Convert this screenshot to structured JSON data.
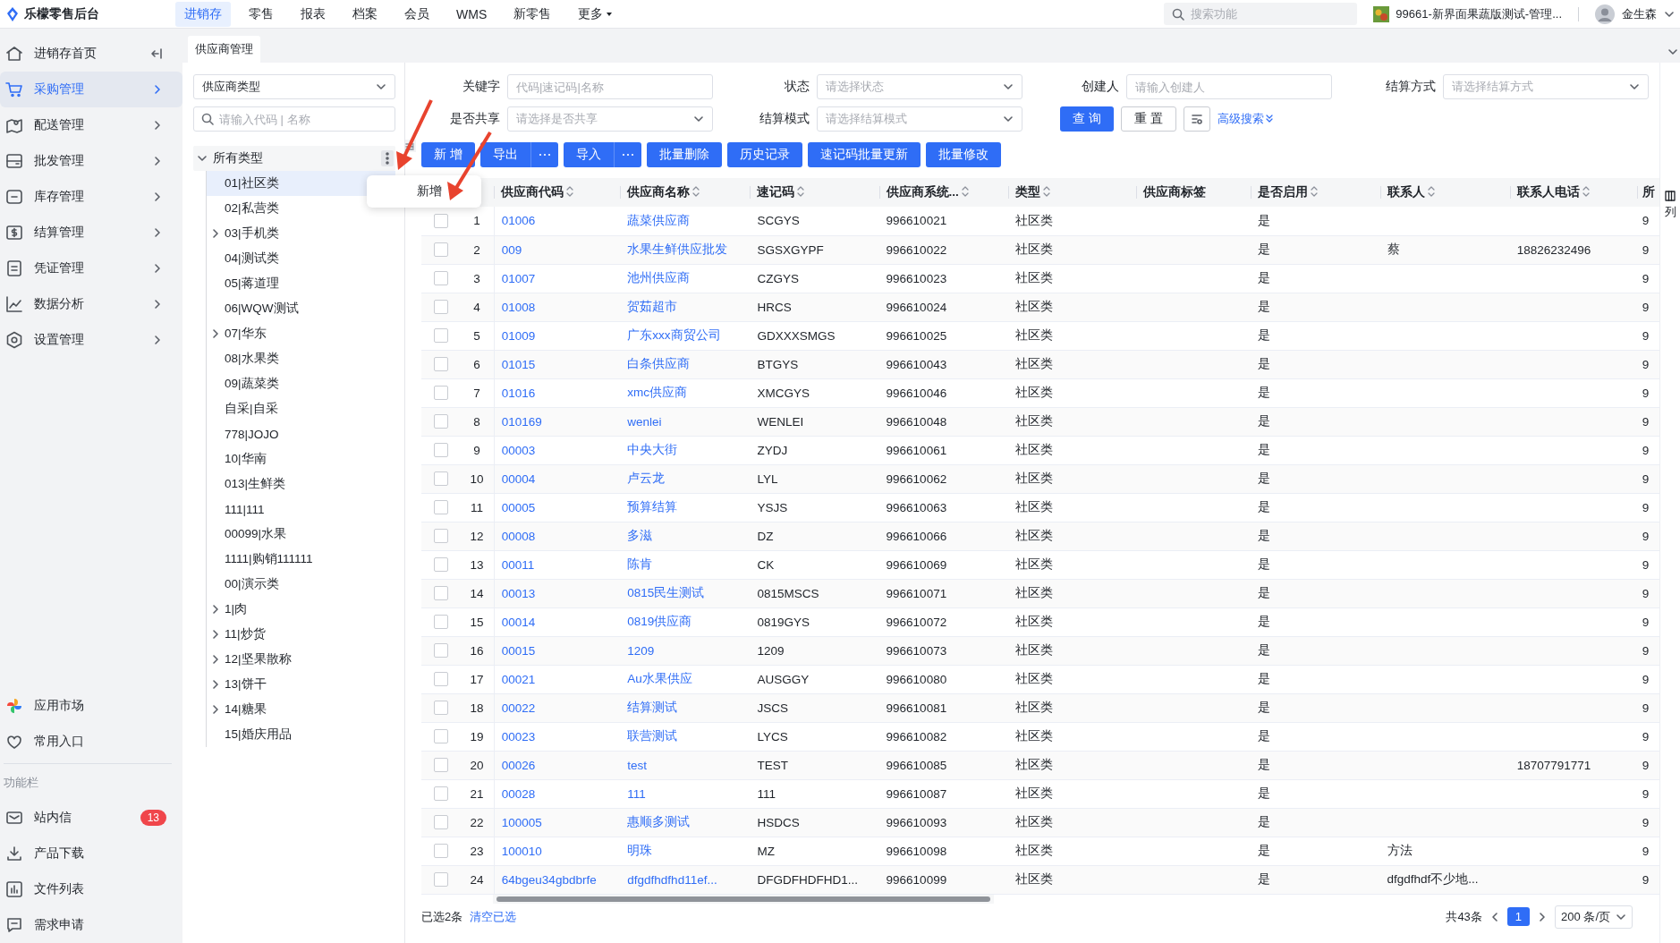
{
  "app": {
    "title": "乐檬零售后台"
  },
  "top_nav": [
    {
      "label": "进销存",
      "selected": true,
      "dropdown": false
    },
    {
      "label": "零售",
      "selected": false,
      "dropdown": false
    },
    {
      "label": "报表",
      "selected": false,
      "dropdown": false
    },
    {
      "label": "档案",
      "selected": false,
      "dropdown": false
    },
    {
      "label": "会员",
      "selected": false,
      "dropdown": false
    },
    {
      "label": "WMS",
      "selected": false,
      "dropdown": false
    },
    {
      "label": "新零售",
      "selected": false,
      "dropdown": false
    },
    {
      "label": "更多",
      "selected": false,
      "dropdown": true
    }
  ],
  "search": {
    "placeholder": "搜索功能"
  },
  "store": {
    "name": "99661-新界面果蔬版测试-管理..."
  },
  "user": {
    "name": "金生森"
  },
  "sidebar": {
    "items": [
      {
        "label": "进销存首页",
        "selected": false,
        "expandable": false
      },
      {
        "label": "采购管理",
        "selected": true,
        "expandable": true
      },
      {
        "label": "配送管理",
        "selected": false,
        "expandable": true
      },
      {
        "label": "批发管理",
        "selected": false,
        "expandable": true
      },
      {
        "label": "库存管理",
        "selected": false,
        "expandable": true
      },
      {
        "label": "结算管理",
        "selected": false,
        "expandable": true
      },
      {
        "label": "凭证管理",
        "selected": false,
        "expandable": true
      },
      {
        "label": "数据分析",
        "selected": false,
        "expandable": true
      },
      {
        "label": "设置管理",
        "selected": false,
        "expandable": true
      }
    ],
    "bottom_items": [
      {
        "label": "应用市场"
      },
      {
        "label": "常用入口"
      }
    ],
    "section_label": "功能栏",
    "tool_items": [
      {
        "label": "站内信",
        "badge": "13"
      },
      {
        "label": "产品下载"
      },
      {
        "label": "文件列表"
      },
      {
        "label": "需求申请"
      }
    ]
  },
  "page_tabs": [
    {
      "label": "供应商管理",
      "selected": true
    }
  ],
  "tree_panel": {
    "type_select": {
      "value": "供应商类型"
    },
    "search": {
      "placeholder": "请输入代码 | 名称"
    },
    "tree": {
      "label": "所有类型",
      "expanded": true,
      "children": [
        {
          "label": "01|社区类",
          "selected": true,
          "expandable": false
        },
        {
          "label": "02|私营类",
          "selected": false,
          "expandable": false
        },
        {
          "label": "03|手机类",
          "selected": false,
          "expandable": true
        },
        {
          "label": "04|测试类",
          "selected": false,
          "expandable": false
        },
        {
          "label": "05|蒋道理",
          "selected": false,
          "expandable": false
        },
        {
          "label": "06|WQW测试",
          "selected": false,
          "expandable": false
        },
        {
          "label": "07|华东",
          "selected": false,
          "expandable": true
        },
        {
          "label": "08|水果类",
          "selected": false,
          "expandable": false
        },
        {
          "label": "09|蔬菜类",
          "selected": false,
          "expandable": false
        },
        {
          "label": "自采|自采",
          "selected": false,
          "expandable": false
        },
        {
          "label": "778|JOJO",
          "selected": false,
          "expandable": false
        },
        {
          "label": "10|华南",
          "selected": false,
          "expandable": false
        },
        {
          "label": "013|生鲜类",
          "selected": false,
          "expandable": false
        },
        {
          "label": "111|111",
          "selected": false,
          "expandable": false
        },
        {
          "label": "00099|水果",
          "selected": false,
          "expandable": false
        },
        {
          "label": "1111|购销111111",
          "selected": false,
          "expandable": false
        },
        {
          "label": "00|演示类",
          "selected": false,
          "expandable": false
        },
        {
          "label": "1|肉",
          "selected": false,
          "expandable": true
        },
        {
          "label": "11|炒货",
          "selected": false,
          "expandable": true
        },
        {
          "label": "12|坚果散称",
          "selected": false,
          "expandable": true
        },
        {
          "label": "13|饼干",
          "selected": false,
          "expandable": true
        },
        {
          "label": "14|糖果",
          "selected": false,
          "expandable": true
        },
        {
          "label": "15|婚庆用品",
          "selected": false,
          "expandable": false
        }
      ]
    }
  },
  "context_menu": {
    "items": [
      "新增"
    ]
  },
  "filters": [
    {
      "label": "关键字",
      "placeholder": "代码|速记码|名称",
      "kind": "input"
    },
    {
      "label": "状态",
      "placeholder": "请选择状态",
      "kind": "select"
    },
    {
      "label": "创建人",
      "placeholder": "请输入创建人",
      "kind": "input"
    },
    {
      "label": "结算方式",
      "placeholder": "请选择结算方式",
      "kind": "select"
    },
    {
      "label": "是否共享",
      "placeholder": "请选择是否共享",
      "kind": "select"
    },
    {
      "label": "结算模式",
      "placeholder": "请选择结算模式",
      "kind": "select"
    }
  ],
  "filter_buttons": {
    "query": "查 询",
    "reset": "重 置",
    "advanced": "高级搜索"
  },
  "toolbar": [
    {
      "label": "新 增",
      "kind": "button"
    },
    {
      "label": "导出",
      "kind": "split"
    },
    {
      "label": "导入",
      "kind": "split"
    },
    {
      "label": "批量删除",
      "kind": "button"
    },
    {
      "label": "历史记录",
      "kind": "button"
    },
    {
      "label": "速记码批量更新",
      "kind": "button"
    },
    {
      "label": "批量修改",
      "kind": "button"
    }
  ],
  "table": {
    "columns": [
      {
        "label": "供应商代码",
        "sortable": true,
        "kind": "link"
      },
      {
        "label": "供应商名称",
        "sortable": true,
        "kind": "link"
      },
      {
        "label": "速记码",
        "sortable": true,
        "kind": "text"
      },
      {
        "label": "供应商系统...",
        "sortable": true,
        "kind": "text"
      },
      {
        "label": "类型",
        "sortable": true,
        "kind": "text"
      },
      {
        "label": "供应商标签",
        "sortable": false,
        "kind": "text"
      },
      {
        "label": "是否启用",
        "sortable": true,
        "kind": "text"
      },
      {
        "label": "联系人",
        "sortable": true,
        "kind": "text"
      },
      {
        "label": "联系人电话",
        "sortable": true,
        "kind": "text"
      },
      {
        "label": "所",
        "sortable": false,
        "kind": "text"
      }
    ],
    "rows": [
      {
        "index": "1",
        "checked": false,
        "cells": [
          "01006",
          "蔬菜供应商",
          "SCGYS",
          "996610021",
          "社区类",
          "",
          "是",
          "",
          "",
          "9"
        ]
      },
      {
        "index": "2",
        "checked": false,
        "cells": [
          "009",
          "水果生鲜供应批发",
          "SGSXGYPF",
          "996610022",
          "社区类",
          "",
          "是",
          "蔡",
          "18826232496",
          "9"
        ]
      },
      {
        "index": "3",
        "checked": false,
        "cells": [
          "01007",
          "池州供应商",
          "CZGYS",
          "996610023",
          "社区类",
          "",
          "是",
          "",
          "",
          "9"
        ]
      },
      {
        "index": "4",
        "checked": false,
        "cells": [
          "01008",
          "贺茹超市",
          "HRCS",
          "996610024",
          "社区类",
          "",
          "是",
          "",
          "",
          "9"
        ]
      },
      {
        "index": "5",
        "checked": false,
        "cells": [
          "01009",
          "广东xxx商贸公司",
          "GDXXXSMGS",
          "996610025",
          "社区类",
          "",
          "是",
          "",
          "",
          "9"
        ]
      },
      {
        "index": "6",
        "checked": false,
        "cells": [
          "01015",
          "白条供应商",
          "BTGYS",
          "996610043",
          "社区类",
          "",
          "是",
          "",
          "",
          "9"
        ]
      },
      {
        "index": "7",
        "checked": false,
        "cells": [
          "01016",
          "xmc供应商",
          "XMCGYS",
          "996610046",
          "社区类",
          "",
          "是",
          "",
          "",
          "9"
        ]
      },
      {
        "index": "8",
        "checked": false,
        "cells": [
          "010169",
          "wenlei",
          "WENLEI",
          "996610048",
          "社区类",
          "",
          "是",
          "",
          "",
          "9"
        ]
      },
      {
        "index": "9",
        "checked": false,
        "cells": [
          "00003",
          "中央大街",
          "ZYDJ",
          "996610061",
          "社区类",
          "",
          "是",
          "",
          "",
          "9"
        ]
      },
      {
        "index": "10",
        "checked": false,
        "cells": [
          "00004",
          "卢云龙",
          "LYL",
          "996610062",
          "社区类",
          "",
          "是",
          "",
          "",
          "9"
        ]
      },
      {
        "index": "11",
        "checked": false,
        "cells": [
          "00005",
          "预算结算",
          "YSJS",
          "996610063",
          "社区类",
          "",
          "是",
          "",
          "",
          "9"
        ]
      },
      {
        "index": "12",
        "checked": false,
        "cells": [
          "00008",
          "多滋",
          "DZ",
          "996610066",
          "社区类",
          "",
          "是",
          "",
          "",
          "9"
        ]
      },
      {
        "index": "13",
        "checked": false,
        "cells": [
          "00011",
          "陈肯",
          "CK",
          "996610069",
          "社区类",
          "",
          "是",
          "",
          "",
          "9"
        ]
      },
      {
        "index": "14",
        "checked": false,
        "cells": [
          "00013",
          "0815民生测试",
          "0815MSCS",
          "996610071",
          "社区类",
          "",
          "是",
          "",
          "",
          "9"
        ]
      },
      {
        "index": "15",
        "checked": false,
        "cells": [
          "00014",
          "0819供应商",
          "0819GYS",
          "996610072",
          "社区类",
          "",
          "是",
          "",
          "",
          "9"
        ]
      },
      {
        "index": "16",
        "checked": false,
        "cells": [
          "00015",
          "1209",
          "1209",
          "996610073",
          "社区类",
          "",
          "是",
          "",
          "",
          "9"
        ]
      },
      {
        "index": "17",
        "checked": false,
        "cells": [
          "00021",
          "Au水果供应",
          "AUSGGY",
          "996610080",
          "社区类",
          "",
          "是",
          "",
          "",
          "9"
        ]
      },
      {
        "index": "18",
        "checked": false,
        "cells": [
          "00022",
          "结算测试",
          "JSCS",
          "996610081",
          "社区类",
          "",
          "是",
          "",
          "",
          "9"
        ]
      },
      {
        "index": "19",
        "checked": false,
        "cells": [
          "00023",
          "联营测试",
          "LYCS",
          "996610082",
          "社区类",
          "",
          "是",
          "",
          "",
          "9"
        ]
      },
      {
        "index": "20",
        "checked": false,
        "cells": [
          "00026",
          "test",
          "TEST",
          "996610085",
          "社区类",
          "",
          "是",
          "",
          "18707791771",
          "9"
        ]
      },
      {
        "index": "21",
        "checked": false,
        "cells": [
          "00028",
          "111",
          "111",
          "996610087",
          "社区类",
          "",
          "是",
          "",
          "",
          "9"
        ]
      },
      {
        "index": "22",
        "checked": false,
        "cells": [
          "100005",
          "惠顺多测试",
          "HSDCS",
          "996610093",
          "社区类",
          "",
          "是",
          "",
          "",
          "9"
        ]
      },
      {
        "index": "23",
        "checked": false,
        "cells": [
          "100010",
          "明珠",
          "MZ",
          "996610098",
          "社区类",
          "",
          "是",
          "方法",
          "",
          "9"
        ]
      },
      {
        "index": "24",
        "checked": false,
        "cells": [
          "64bgeu34gbdbrfe",
          "dfgdfhdfhd11ef...",
          "DFGDFHDFHD1...",
          "996610099",
          "社区类",
          "",
          "是",
          "dfgdfhdf不少地...",
          "",
          "9"
        ]
      }
    ]
  },
  "column_settings": {
    "label": "列"
  },
  "footer": {
    "selected_text": "已选2条",
    "clear": "清空已选",
    "total": "共43条",
    "page": "1",
    "page_size": "200 条/页"
  }
}
